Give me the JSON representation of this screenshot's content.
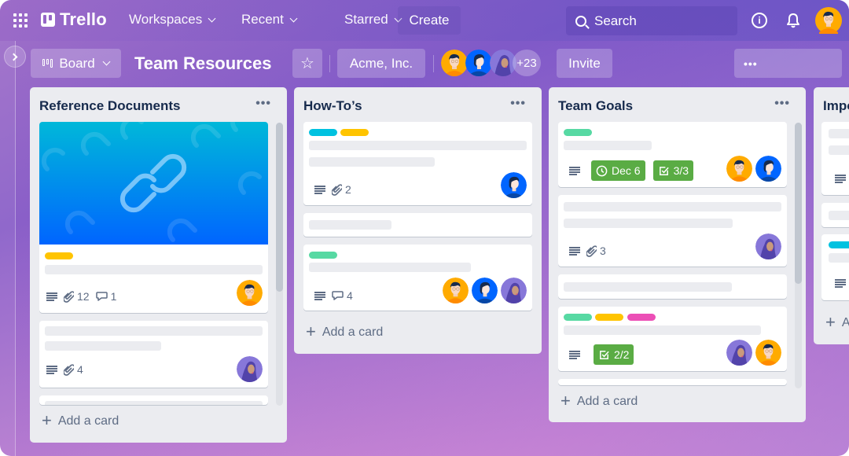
{
  "topnav": {
    "app_name": "Trello",
    "menus": [
      {
        "label": "Workspaces"
      },
      {
        "label": "Recent"
      },
      {
        "label": "Starred"
      }
    ],
    "create_label": "Create",
    "search_placeholder": "Search",
    "info_glyph": "i"
  },
  "board": {
    "view_label": "Board",
    "title": "Team Resources",
    "star_glyph": "☆",
    "workspace": "Acme, Inc.",
    "extra_members": "+23",
    "invite_label": "Invite",
    "menu_glyph": "•••"
  },
  "colors": {
    "label_teal": "#00c2e0",
    "label_yellow": "#ffc400",
    "label_green": "#57d9a3",
    "label_pink": "#ec4fb6",
    "badge_green": "#5aac44",
    "avatar_orange": "#ffab00",
    "avatar_blue": "#0065ff",
    "avatar_purple": "#8777d9"
  },
  "lists": [
    {
      "title": "Reference Documents",
      "menu": "•••",
      "add_card": "Add a card",
      "cards": [
        {
          "cover": "link-icon",
          "labels": [
            "yellow"
          ],
          "attachments": "12",
          "comments": "1",
          "members": [
            "orange"
          ]
        },
        {
          "attachments": "4",
          "members": [
            "purple"
          ]
        }
      ]
    },
    {
      "title": "How-To’s",
      "menu": "•••",
      "add_card": "Add a card",
      "cards": [
        {
          "labels": [
            "teal",
            "yellow"
          ],
          "attachments": "2",
          "members": [
            "blue"
          ]
        },
        {},
        {
          "labels": [
            "green"
          ],
          "comments": "4",
          "members": [
            "orange",
            "blue",
            "purple"
          ]
        }
      ]
    },
    {
      "title": "Team Goals",
      "menu": "•••",
      "add_card": "Add a card",
      "cards": [
        {
          "labels": [
            "green"
          ],
          "due": "Dec 6",
          "checklist": "3/3",
          "members": [
            "orange",
            "blue"
          ]
        },
        {
          "attachments": "3",
          "members": [
            "purple"
          ]
        },
        {},
        {
          "labels": [
            "green",
            "yellow",
            "pink"
          ],
          "checklist": "2/2",
          "members": [
            "purple",
            "orange"
          ]
        }
      ]
    },
    {
      "title": "Impo",
      "add_card": "A"
    }
  ]
}
